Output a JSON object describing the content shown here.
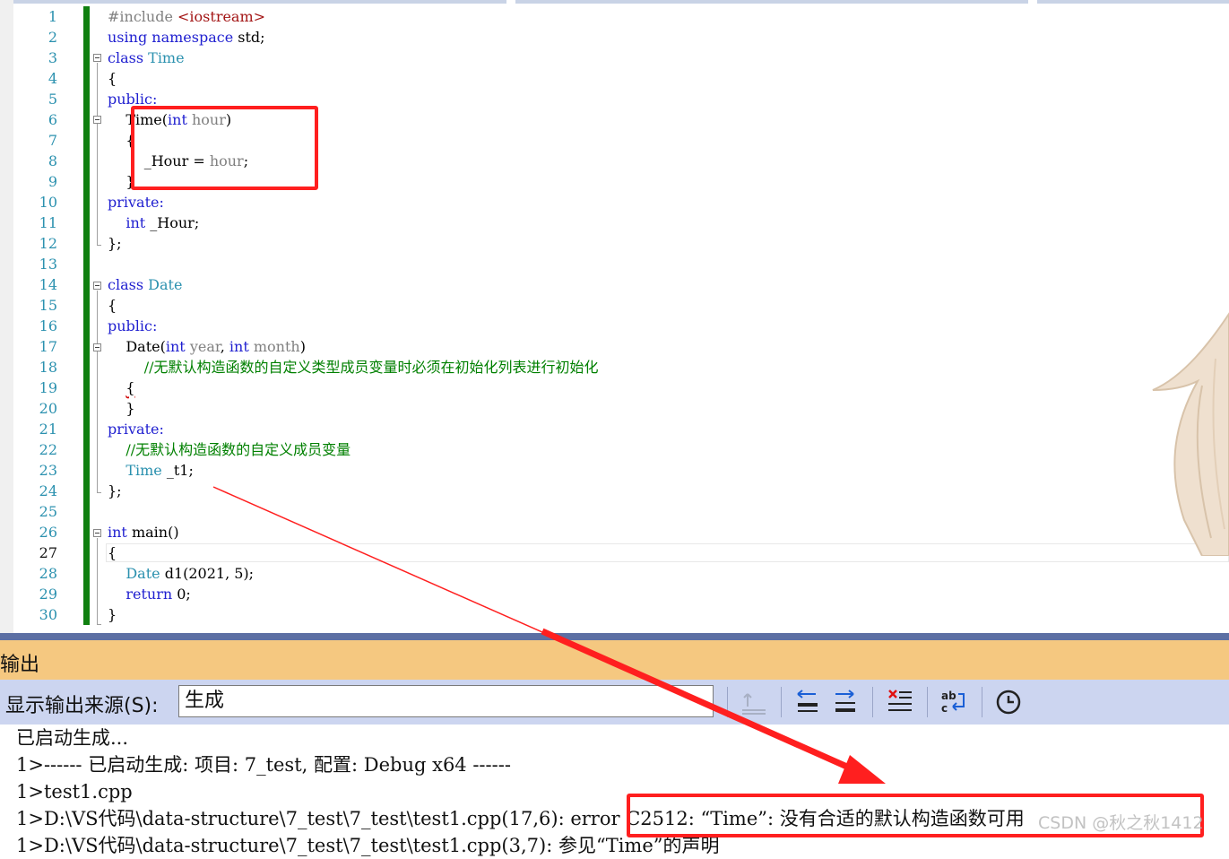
{
  "editor": {
    "line_numbers": [
      "1",
      "2",
      "3",
      "4",
      "5",
      "6",
      "7",
      "8",
      "9",
      "10",
      "11",
      "12",
      "13",
      "14",
      "15",
      "16",
      "17",
      "18",
      "19",
      "20",
      "21",
      "22",
      "23",
      "24",
      "25",
      "26",
      "27",
      "28",
      "29",
      "30"
    ],
    "current_line": "27",
    "code": {
      "l1_pp": "#include ",
      "l1_hdr": "<iostream>",
      "l2_using": "using",
      "l2_ns": "namespace",
      "l2_rest": " std;",
      "l3_class": "class",
      "l3_name": "Time",
      "l4": "{",
      "l5": "public:",
      "l6_name": "Time",
      "l6_open": "(",
      "l6_int": "int",
      "l6_param": "hour",
      "l6_close": ")",
      "l7": "{",
      "l8_member": "_Hour",
      "l8_eq": " = ",
      "l8_param": "hour",
      "l8_end": ";",
      "l9": "}",
      "l10": "private:",
      "l11_int": "int",
      "l11_rest": " _Hour;",
      "l12": "};",
      "l14_class": "class",
      "l14_name": "Date",
      "l15": "{",
      "l16": "public:",
      "l17_name": "Date",
      "l17_open": "(",
      "l17_int1": "int",
      "l17_p1": "year",
      "l17_comma": ", ",
      "l17_int2": "int",
      "l17_p2": "month",
      "l17_close": ")",
      "l18": "//无默认构造函数的自定义类型成员变量时必须在初始化列表进行初始化",
      "l19": "{",
      "l20": "}",
      "l21": "private:",
      "l22": "//无默认构造函数的自定义成员变量",
      "l23_type": "Time",
      "l23_rest": " _t1;",
      "l24": "};",
      "l26_int": "int",
      "l26_rest": " main()",
      "l27": "{",
      "l28_type": "Date",
      "l28_rest": " d1(2021, 5);",
      "l29_ret": "return",
      "l29_rest": " 0;",
      "l30": "}"
    }
  },
  "output": {
    "title": "输出",
    "source_label": "显示输出来源(S):",
    "source_value": "生成",
    "toolbar_icons": [
      "goto-source-icon",
      "previous-message-icon",
      "next-message-icon",
      "clear-all-icon",
      "toggle-word-wrap-icon",
      "timestamp-clock-icon"
    ],
    "lines": [
      "已启动生成...",
      "1>------ 已启动生成: 项目: 7_test, 配置: Debug x64 ------",
      "1>test1.cpp",
      "1>D:\\VS代码\\data-structure\\7_test\\7_test\\test1.cpp(17,6): error C2512: “Time”: 没有合适的默认构造函数可用",
      "1>D:\\VS代码\\data-structure\\7_test\\7_test\\test1.cpp(3,7): 参见“Time”的声明"
    ]
  },
  "watermark": "CSDN @秋之秋1412",
  "colors": {
    "keyword": "#1f1fd0",
    "type": "#2b91af",
    "comment": "#008000",
    "annotation_red": "#ff1f1f",
    "output_title_bg": "#f5c880",
    "output_toolbar_bg": "#ccd5f0"
  }
}
